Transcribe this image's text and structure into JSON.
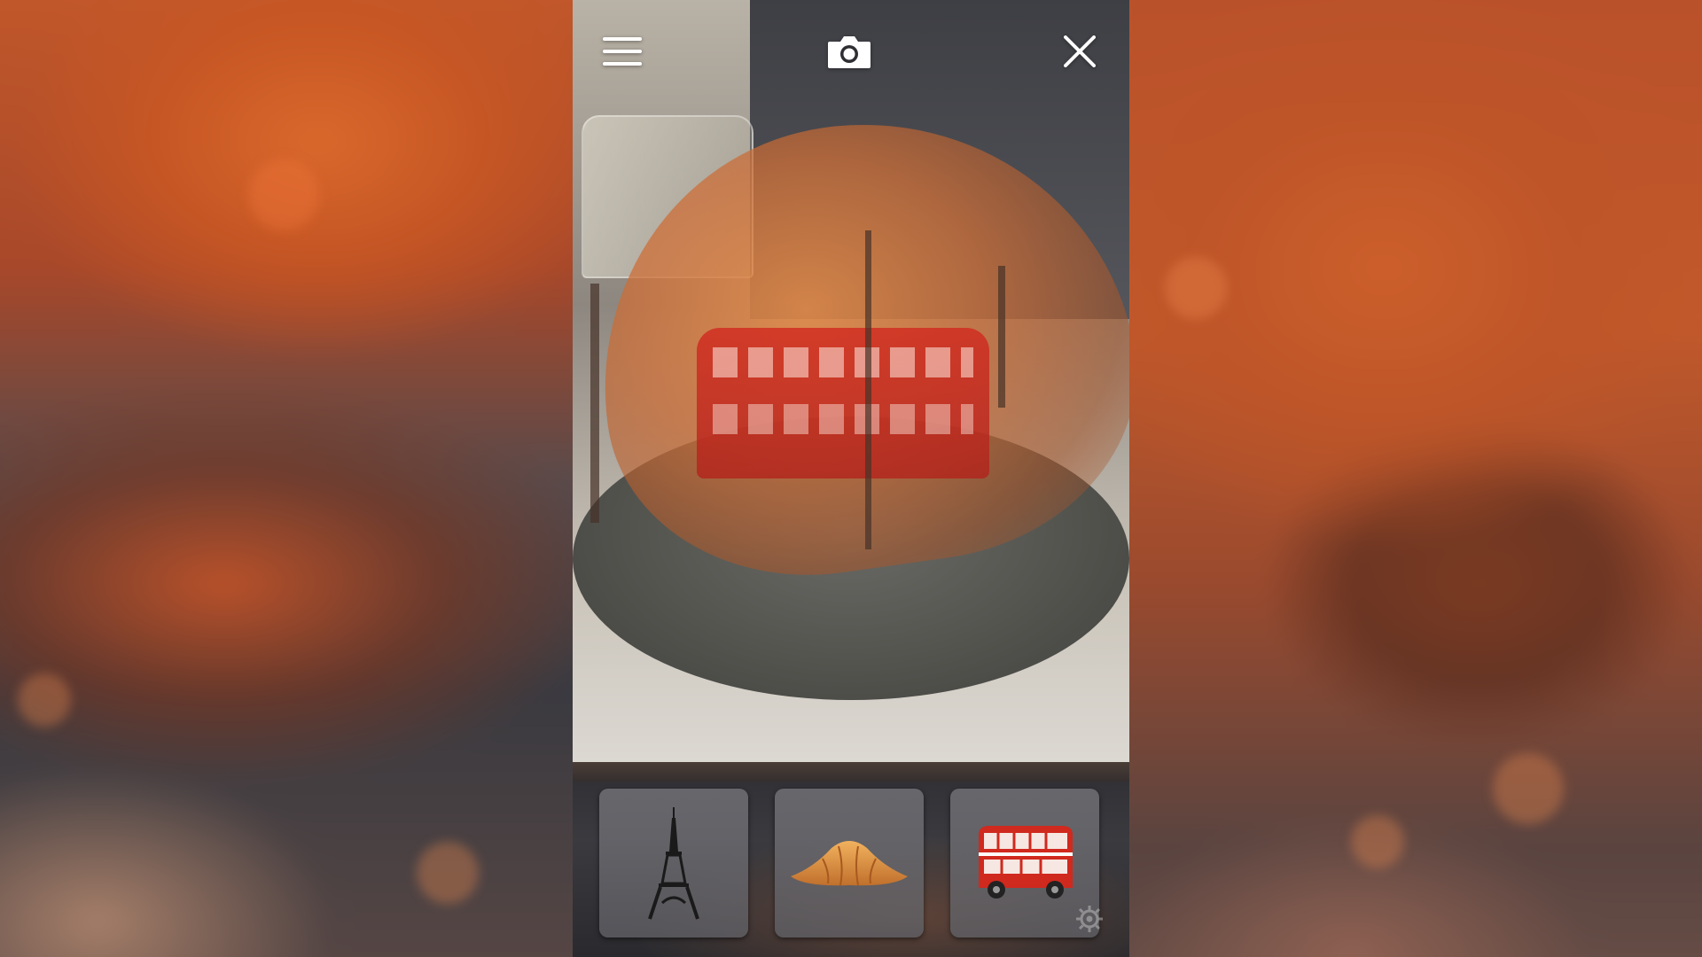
{
  "app": {
    "header": {
      "menu_icon": "hamburger-menu-icon",
      "camera_icon": "camera-icon",
      "close_icon": "close-icon"
    },
    "scene": {
      "overlay_objects": [
        "croissant",
        "double-decker-bus"
      ]
    },
    "tray": {
      "items": [
        {
          "icon": "eiffel-tower-icon"
        },
        {
          "icon": "croissant-icon"
        },
        {
          "icon": "london-bus-icon"
        }
      ],
      "settings_icon": "gear-icon"
    },
    "colors": {
      "accent_orange": "#d9682c",
      "bus_red": "#d0291e",
      "tile_gray": "#6e6e73"
    }
  }
}
